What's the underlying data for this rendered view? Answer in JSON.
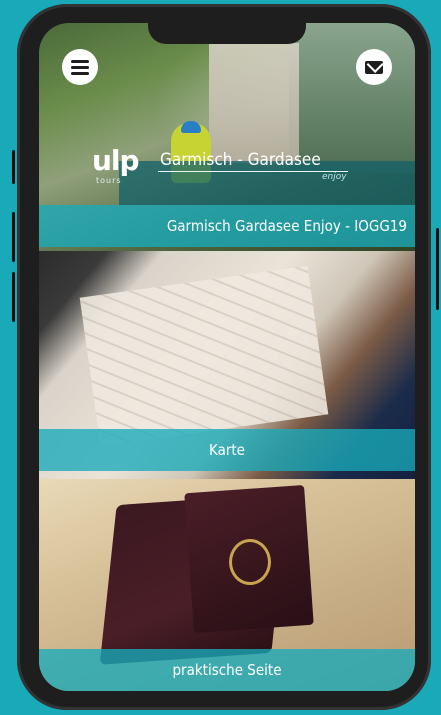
{
  "header": {
    "menu_icon": "menu-icon",
    "mail_icon": "mail-icon"
  },
  "logo": {
    "mark": "ulp",
    "tours": "tours"
  },
  "route": {
    "title": "Garmisch - Gardasee",
    "subtitle": "enjoy"
  },
  "tiles": [
    {
      "label": "Garmisch Gardasee Enjoy - IOGG19",
      "image": "mountain-bike-photo"
    },
    {
      "label": "Karte",
      "image": "map-photo"
    },
    {
      "label": "praktische Seite",
      "image": "passport-photo"
    }
  ],
  "colors": {
    "background": "#1aa9b8",
    "band": "#18aaba",
    "phone": "#1e1e1e"
  }
}
